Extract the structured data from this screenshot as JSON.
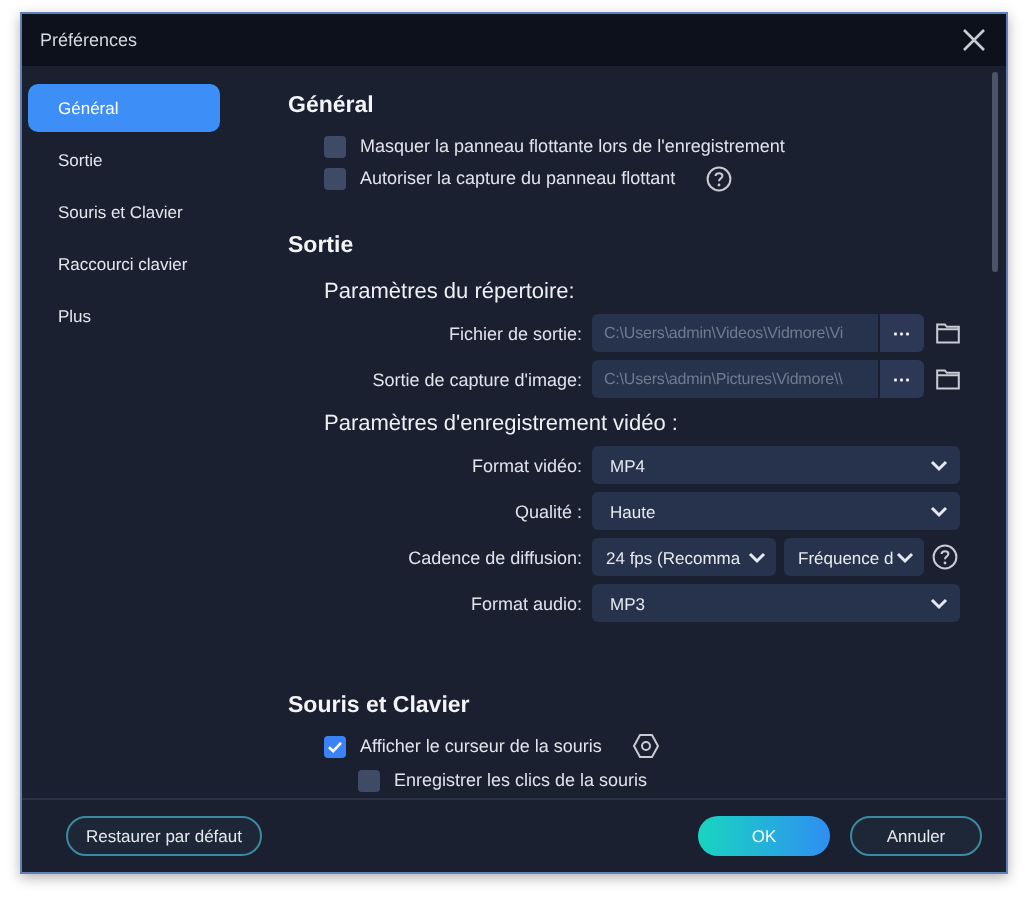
{
  "window": {
    "title": "Préférences"
  },
  "sidebar": {
    "items": [
      {
        "label": "Général",
        "selected": true
      },
      {
        "label": "Sortie",
        "selected": false
      },
      {
        "label": "Souris et Clavier",
        "selected": false
      },
      {
        "label": "Raccourci clavier",
        "selected": false
      },
      {
        "label": "Plus",
        "selected": false
      }
    ]
  },
  "sections": [
    {
      "title": "Général",
      "rows": [
        {
          "kind": "checkbox",
          "label": "Masquer la panneau flottante lors de l'enregistrement",
          "checked": false
        },
        {
          "kind": "checkbox",
          "label": "Autoriser la capture du panneau flottant",
          "checked": false,
          "help_button": true
        }
      ]
    },
    {
      "title": "Sortie",
      "rows": [
        {
          "kind": "subheading",
          "label": "Paramètres du répertoire:"
        },
        {
          "kind": "path",
          "label": "Fichier de sortie:",
          "value": "C:\\Users\\admin\\Videos\\Vidmore\\Vi",
          "button": "···"
        },
        {
          "kind": "path",
          "label": "Sortie de capture d'image:",
          "value": "C:\\Users\\admin\\Pictures\\Vidmore\\\\",
          "button": "···"
        },
        {
          "kind": "subheading",
          "label": "Paramètres d'enregistrement vidéo :"
        },
        {
          "kind": "select",
          "label": "Format vidéo:",
          "value": "MP4"
        },
        {
          "kind": "select",
          "label": "Qualité :",
          "value": "Haute"
        },
        {
          "kind": "double_select",
          "label": "Cadence de diffusion:",
          "values": [
            "24 fps (Recomma",
            "Fréquence d"
          ],
          "help_button": true
        },
        {
          "kind": "select",
          "label": "Format audio:",
          "value": "MP3"
        }
      ]
    },
    {
      "title": "Souris et Clavier",
      "rows": [
        {
          "kind": "checkbox",
          "label": "Afficher le curseur de la souris",
          "checked": true,
          "settings_button": true,
          "children": [
            {
              "kind": "checkbox",
              "label": "Enregistrer les clics de la souris",
              "checked": false
            }
          ]
        }
      ]
    }
  ],
  "footer": {
    "reset": "Restaurer par défaut",
    "ok": "OK",
    "cancel": "Annuler"
  }
}
